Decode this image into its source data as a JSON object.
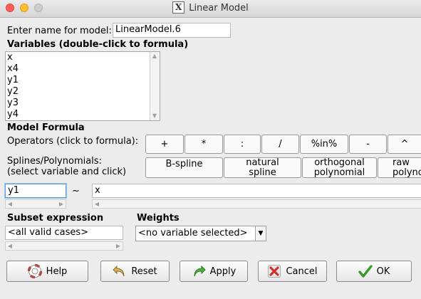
{
  "window": {
    "title": "Linear Model",
    "icon": "x11-icon"
  },
  "model_name": {
    "label": "Enter name for model:",
    "value": "LinearModel.6"
  },
  "variables": {
    "label": "Variables (double-click to formula)",
    "items": [
      "x",
      "x4",
      "y1",
      "y2",
      "y3",
      "y4"
    ]
  },
  "formula": {
    "section_label": "Model Formula",
    "operators_label": "Operators (click to formula):",
    "operators": [
      "+",
      "*",
      ":",
      "/",
      "%in%",
      "-",
      "^"
    ],
    "splines_label_1": "Splines/Polynomials:",
    "splines_label_2": "(select variable and click)",
    "spline_buttons": {
      "bspline": "B-spline",
      "natural_1": "natural",
      "natural_2": "spline",
      "orthogonal_1": "orthogonal",
      "orthogonal_2": "polynomial",
      "raw_1": "raw",
      "raw_2": "polyno"
    },
    "lhs": "y1",
    "tilde": "~",
    "rhs": "x"
  },
  "subset": {
    "label": "Subset expression",
    "value": "<all valid cases>"
  },
  "weights": {
    "label": "Weights",
    "selected": "<no variable selected>"
  },
  "buttons": {
    "help": "Help",
    "reset": "Reset",
    "apply": "Apply",
    "cancel": "Cancel",
    "ok": "OK"
  },
  "icons": {
    "help": "lifebuoy-icon",
    "reset": "undo-arrow-icon",
    "apply": "redo-arrow-icon",
    "cancel": "red-x-icon",
    "ok": "green-check-icon"
  }
}
